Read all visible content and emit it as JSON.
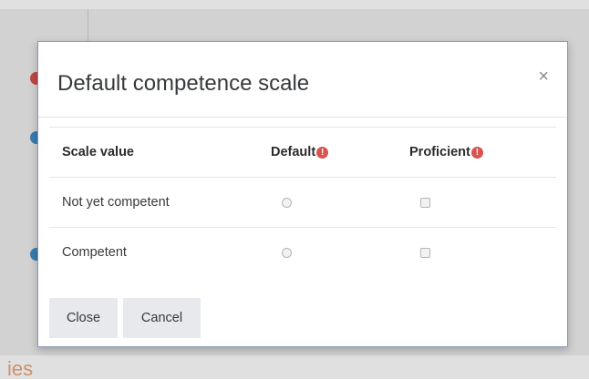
{
  "background": {
    "partial_text": "ies"
  },
  "modal": {
    "title": "Default competence scale",
    "close_glyph": "×",
    "columns": {
      "scale_value": "Scale value",
      "default": "Default",
      "proficient": "Proficient"
    },
    "info_glyph": "!",
    "rows": [
      {
        "label": "Not yet competent",
        "default_selected": false,
        "proficient_checked": false
      },
      {
        "label": "Competent",
        "default_selected": false,
        "proficient_checked": false
      }
    ],
    "buttons": {
      "close": "Close",
      "cancel": "Cancel"
    }
  },
  "colors": {
    "info_icon": "#d9534f",
    "modal_border": "#8a9bb5",
    "button_bg": "#e7e9ec"
  }
}
